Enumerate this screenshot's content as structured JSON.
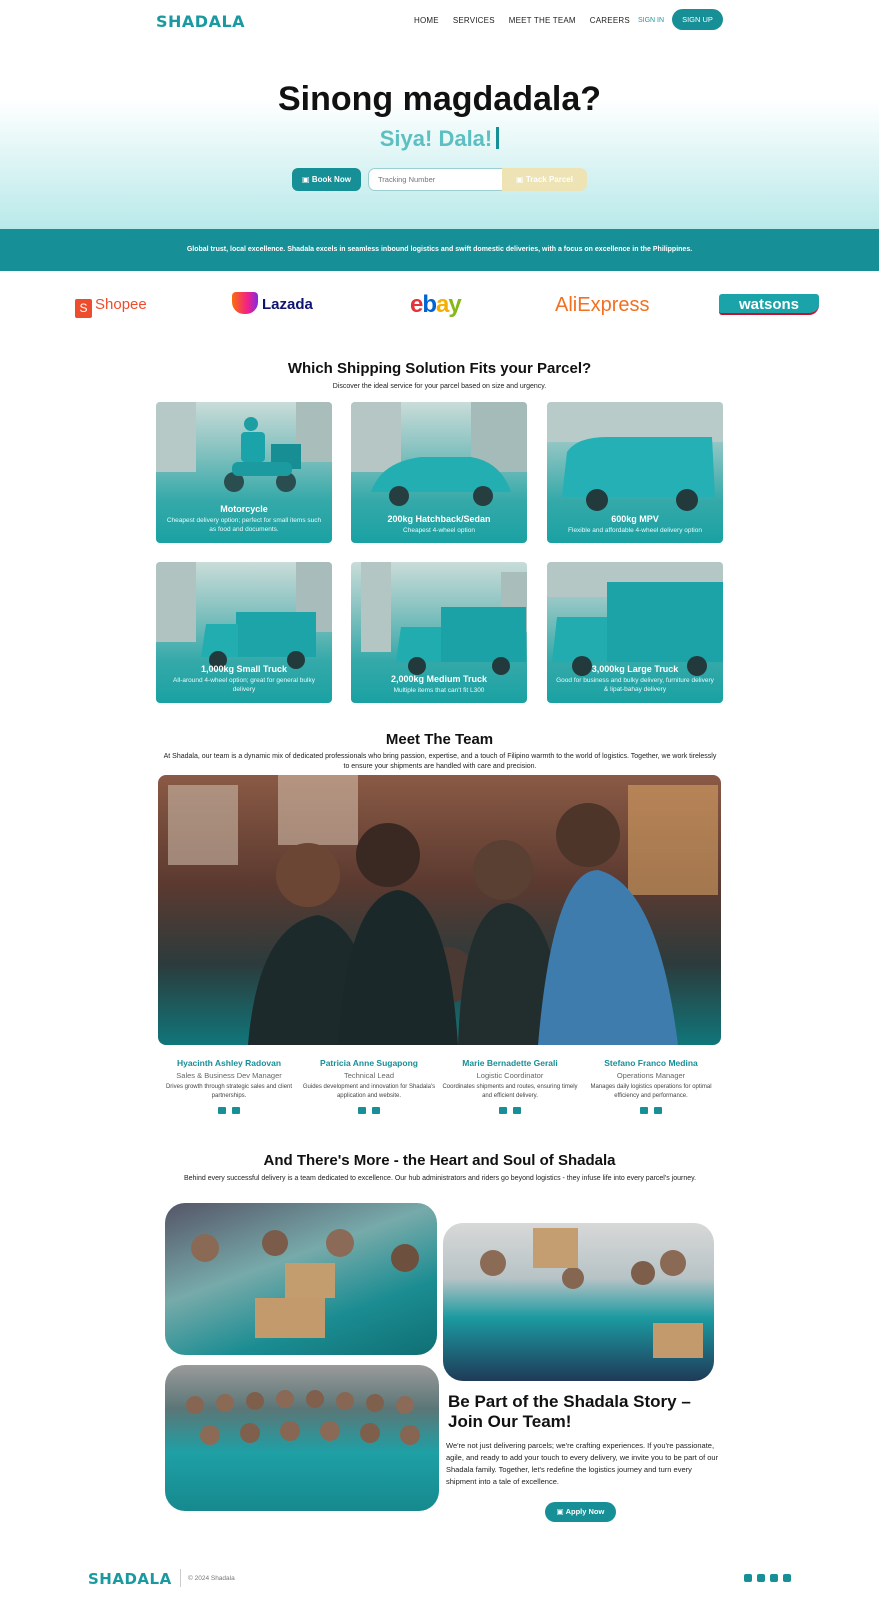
{
  "nav": {
    "logo": "SHADALA",
    "links": [
      "HOME",
      "SERVICES",
      "MEET THE TEAM",
      "CAREERS"
    ],
    "sign_in": "SIGN IN",
    "sign_up": "SIGN UP"
  },
  "hero": {
    "title": "Sinong magdadala?",
    "subtitle": "Siya! Dala!",
    "book_button": "Book Now",
    "tracking_placeholder": "Tracking Number",
    "track_button": "Track Parcel"
  },
  "banner": {
    "text": "Global trust, local excellence. Shadala excels in seamless inbound logistics and swift domestic deliveries, with a focus on excellence in the Philippines."
  },
  "partners": [
    "Shopee",
    "Lazada",
    "ebay",
    "AliExpress",
    "watsons"
  ],
  "shipping": {
    "title": "Which Shipping Solution Fits your Parcel?",
    "subtitle": "Discover the ideal service for your parcel based on size and urgency.",
    "options": [
      {
        "title": "Motorcycle",
        "desc": "Cheapest delivery option; perfect for small items such as food and documents."
      },
      {
        "title": "200kg Hatchback/Sedan",
        "desc": "Cheapest 4-wheel option"
      },
      {
        "title": "600kg MPV",
        "desc": "Flexible and affordable 4-wheel delivery option"
      },
      {
        "title": "1,000kg Small Truck",
        "desc": "All-around 4-wheel option; great for general bulky delivery"
      },
      {
        "title": "2,000kg Medium Truck",
        "desc": "Multiple items that can't fit L300"
      },
      {
        "title": "3,000kg Large Truck",
        "desc": "Good for business and bulky delivery, furniture delivery & lipat-bahay delivery"
      }
    ]
  },
  "team": {
    "title": "Meet The Team",
    "subtitle": "At Shadala, our team is a dynamic mix of dedicated professionals who bring passion, expertise, and a touch of Filipino warmth to the world of logistics. Together, we work tirelessly to ensure your shipments are handled with care and precision.",
    "members": [
      {
        "name": "Hyacinth Ashley Radovan",
        "role": "Sales & Business Dev Manager",
        "desc": "Drives growth through strategic sales and client partnerships."
      },
      {
        "name": "Patricia Anne Sugapong",
        "role": "Technical Lead",
        "desc": "Guides development and innovation for Shadala's application and website."
      },
      {
        "name": "Marie Bernadette Gerali",
        "role": "Logistic Coordinator",
        "desc": "Coordinates shipments and routes, ensuring timely and efficient delivery."
      },
      {
        "name": "Stefano Franco Medina",
        "role": "Operations Manager",
        "desc": "Manages daily logistics operations for optimal efficiency and performance."
      }
    ]
  },
  "heart": {
    "title": "And There's More - the Heart and Soul of Shadala",
    "subtitle": "Behind every successful delivery is a team dedicated to excellence. Our hub administrators and riders go beyond logistics - they infuse life into every parcel's journey."
  },
  "join": {
    "title": "Be Part of the Shadala Story – Join Our Team!",
    "text": "We're not just delivering parcels; we're crafting experiences. If you're passionate, agile, and ready to add your touch to every delivery, we invite you to be part of our Shadala family. Together, let's redefine the logistics journey and turn every shipment into a tale of excellence.",
    "apply_button": "Apply Now"
  },
  "footer": {
    "logo": "SHADALA",
    "copyright": "© 2024 Shadala"
  },
  "colors": {
    "accent": "#178f96",
    "accent_light": "#5cbfc2",
    "track_button": "#ede3b4"
  }
}
